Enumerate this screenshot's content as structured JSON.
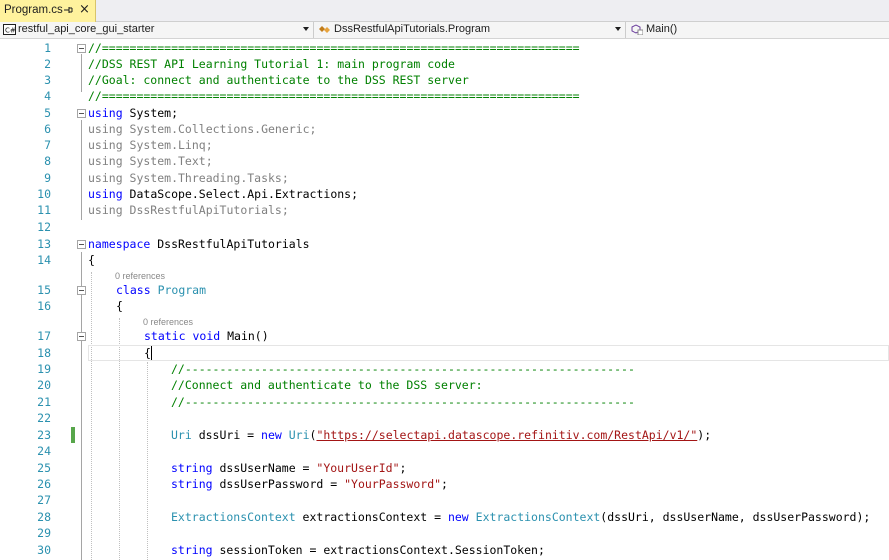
{
  "tab": {
    "name": "Program.cs",
    "close": "×"
  },
  "navbar": {
    "project": "restful_api_core_gui_starter",
    "type": "DssRestfulApiTutorials.Program",
    "member": "Main()"
  },
  "codelens": {
    "program": "0 references",
    "main": "0 references"
  },
  "lines": [
    {
      "n": "1"
    },
    {
      "n": "2"
    },
    {
      "n": "3"
    },
    {
      "n": "4"
    },
    {
      "n": "5"
    },
    {
      "n": "6"
    },
    {
      "n": "7"
    },
    {
      "n": "8"
    },
    {
      "n": "9"
    },
    {
      "n": "10"
    },
    {
      "n": "11"
    },
    {
      "n": "12"
    },
    {
      "n": "13"
    },
    {
      "n": "14"
    },
    {
      "n": "15"
    },
    {
      "n": "16"
    },
    {
      "n": "17"
    },
    {
      "n": "18"
    },
    {
      "n": "19"
    },
    {
      "n": "20"
    },
    {
      "n": "21"
    },
    {
      "n": "22"
    },
    {
      "n": "23"
    },
    {
      "n": "24"
    },
    {
      "n": "25"
    },
    {
      "n": "26"
    },
    {
      "n": "27"
    },
    {
      "n": "28"
    },
    {
      "n": "29"
    },
    {
      "n": "30"
    }
  ],
  "code": {
    "l1": "//=====================================================================",
    "l2": "//DSS REST API Learning Tutorial 1: main program code",
    "l3": "//Goal: connect and authenticate to the DSS REST server",
    "l4": "//=====================================================================",
    "l5_kw": "using",
    "l5_rest": " System;",
    "l6": "using System.Collections.Generic;",
    "l7": "using System.Linq;",
    "l8": "using System.Text;",
    "l9": "using System.Threading.Tasks;",
    "l10_kw": "using",
    "l10_rest": " DataScope.Select.Api.Extractions;",
    "l11": "using DssRestfulApiTutorials;",
    "l13_kw": "namespace",
    "l13_rest": " DssRestfulApiTutorials",
    "l14": "{",
    "l15_kw": "class",
    "l15_type": "Program",
    "l16": "{",
    "l17_kw1": "static",
    "l17_kw2": "void",
    "l17_rest": " Main()",
    "l18": "{",
    "l19": "//-----------------------------------------------------------------",
    "l20": "//Connect and authenticate to the DSS server:",
    "l21": "//-----------------------------------------------------------------",
    "l23_type1": "Uri",
    "l23_mid": " dssUri = ",
    "l23_kw": "new",
    "l23_type2": "Uri",
    "l23_open": "(",
    "l23_url": "\"https://selectapi.datascope.refinitiv.com/RestApi/v1/\"",
    "l23_close": ");",
    "l25_kw": "string",
    "l25_mid": " dssUserName = ",
    "l25_str": "\"YourUserId\"",
    "l25_end": ";",
    "l26_kw": "string",
    "l26_mid": " dssUserPassword = ",
    "l26_str": "\"YourPassword\"",
    "l26_end": ";",
    "l28_type1": "ExtractionsContext",
    "l28_mid": " extractionsContext = ",
    "l28_kw": "new",
    "l28_type2": "ExtractionsContext",
    "l28_end": "(dssUri, dssUserName, dssUserPassword);",
    "l30_kw": "string",
    "l30_rest": " sessionToken = extractionsContext.SessionToken;"
  },
  "colors": {
    "keyword": "#0000ff",
    "comment": "#008000",
    "type": "#2b91af",
    "string": "#a31515",
    "linenum": "#2b91af",
    "tab_active": "#fff29d",
    "change_bar": "#57a64a"
  }
}
